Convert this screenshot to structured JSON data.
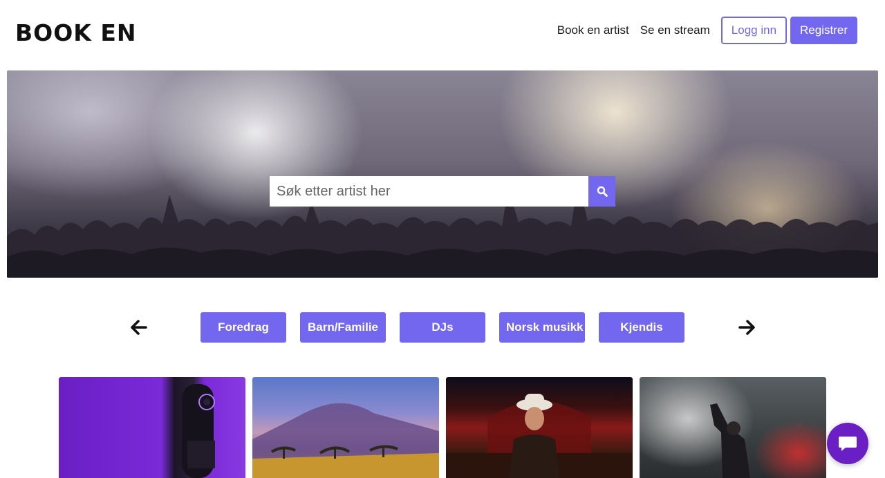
{
  "header": {
    "logo": "BOOK EN",
    "nav": {
      "book_artist": "Book en artist",
      "watch_stream": "Se en stream",
      "login": "Logg inn",
      "register": "Registrer"
    }
  },
  "hero": {
    "search_placeholder": "Søk etter artist her",
    "search_icon": "search-icon"
  },
  "categories": {
    "prev_icon": "arrow-left-icon",
    "next_icon": "arrow-right-icon",
    "items": [
      "Foredrag",
      "Barn/Familie",
      "DJs",
      "Norsk musikk",
      "Kjendis"
    ]
  },
  "cards": [
    {
      "image": "microphone-purple"
    },
    {
      "image": "mountain-savanna"
    },
    {
      "image": "country-singer-stage"
    },
    {
      "image": "performer-smoke"
    }
  ],
  "chat": {
    "icon": "chat-bubble-icon"
  },
  "colors": {
    "accent": "#7367f0",
    "chat": "#6a1fc4"
  }
}
